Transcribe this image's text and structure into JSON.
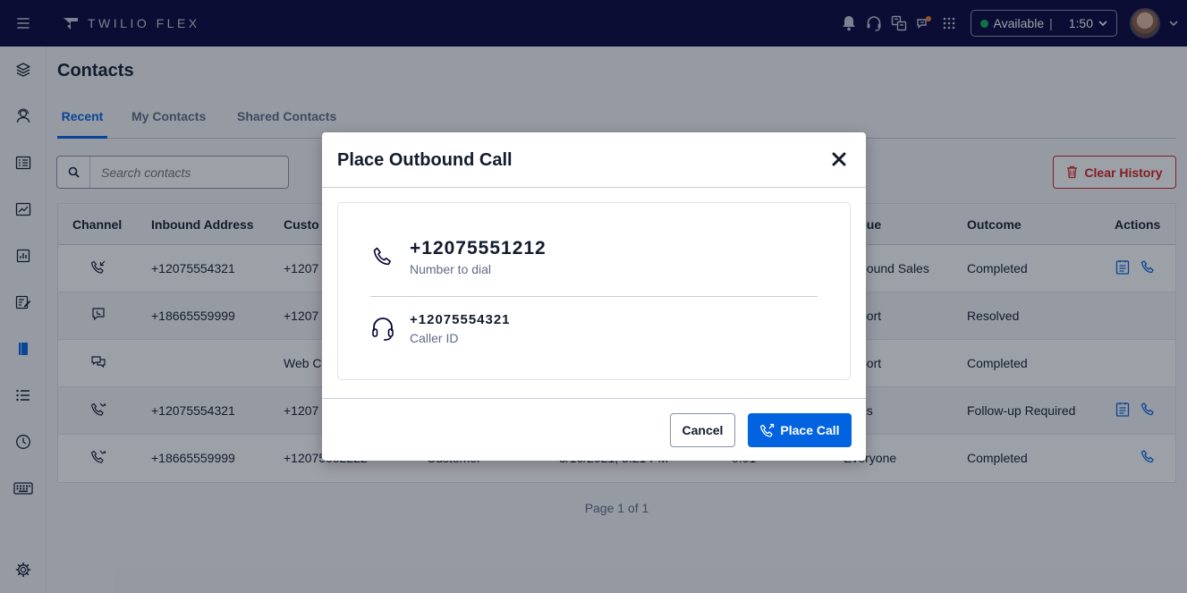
{
  "topbar": {
    "brand": "TWILIO FLEX",
    "status": "Available",
    "timer": "1:50",
    "icons": [
      "bell-icon",
      "headset-icon",
      "translate-icon",
      "activity-icon",
      "grid-icon"
    ]
  },
  "sidebar": {
    "items": [
      "layers-icon",
      "agents-icon",
      "queues-icon",
      "insights-icon",
      "reports-icon",
      "edit-icon",
      "contacts-icon",
      "list-icon",
      "history-icon",
      "keyboard-icon",
      "settings-icon"
    ],
    "active": "contacts-icon"
  },
  "page": {
    "title": "Contacts",
    "tabs": [
      "Recent",
      "My Contacts",
      "Shared Contacts"
    ],
    "active_tab": "Recent",
    "search_placeholder": "Search contacts",
    "clear_history": "Clear History",
    "pager": "Page 1 of 1"
  },
  "table": {
    "headers": [
      "Channel",
      "Inbound Address",
      "Custo",
      "eue",
      "Outcome",
      "Actions"
    ],
    "rows": [
      {
        "channel": "phone-incoming-icon",
        "inbound": "+12075554321",
        "customer": "+1207",
        "queue": "bound Sales",
        "outcome": "Completed",
        "actions": [
          "notes-icon",
          "phone-icon"
        ]
      },
      {
        "channel": "sms-icon",
        "inbound": "+18665559999",
        "customer": "+1207",
        "queue": "port",
        "outcome": "Resolved",
        "actions": []
      },
      {
        "channel": "chat-icon",
        "inbound": "",
        "customer": "Web C",
        "queue": "port",
        "outcome": "Completed",
        "actions": []
      },
      {
        "channel": "phone-missed-icon",
        "inbound": "+12075554321",
        "customer": "+1207",
        "queue": "es",
        "outcome": "Follow-up Required",
        "actions": [
          "notes-icon",
          "phone-icon"
        ]
      },
      {
        "channel": "phone-missed-icon",
        "inbound": "+18665559999",
        "customer": "+12075552222",
        "name": "Customer",
        "date": "3/16/2021, 3:21 PM",
        "duration": "0:01",
        "queue": "Everyone",
        "outcome": "Completed",
        "actions": [
          "phone-icon"
        ]
      }
    ]
  },
  "modal": {
    "title": "Place Outbound Call",
    "number_to_dial": "+12075551212",
    "number_to_dial_label": "Number to dial",
    "caller_id": "+12075554321",
    "caller_id_label": "Caller ID",
    "cancel": "Cancel",
    "place_call": "Place Call"
  },
  "colors": {
    "topbar": "#06033a",
    "primary": "#0263e0",
    "danger": "#d61f1f",
    "available": "#14b053"
  }
}
